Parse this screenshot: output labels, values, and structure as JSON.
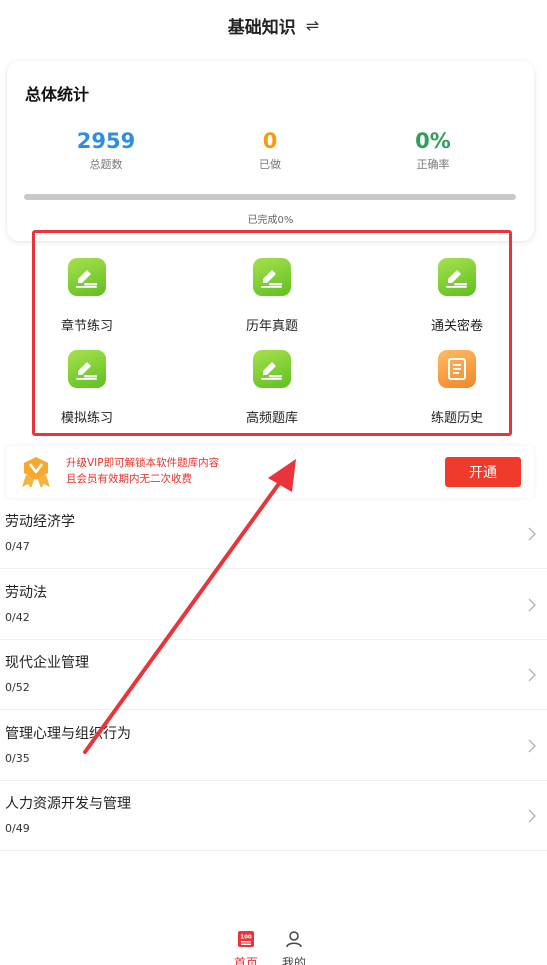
{
  "header": {
    "title": "基础知识",
    "switch_icon": "⇌"
  },
  "stats": {
    "title": "总体统计",
    "total": {
      "value": "2959",
      "label": "总题数"
    },
    "done": {
      "value": "0",
      "label": "已做"
    },
    "rate": {
      "value": "0%",
      "label": "正确率"
    },
    "progress": 0,
    "progress_text": "已完成0%"
  },
  "features": [
    {
      "label": "章节练习",
      "icon": "edit-icon",
      "color": "#6fc72e"
    },
    {
      "label": "历年真题",
      "icon": "edit-icon",
      "color": "#6fc72e"
    },
    {
      "label": "通关密卷",
      "icon": "edit-icon",
      "color": "#6fc72e"
    },
    {
      "label": "模拟练习",
      "icon": "edit-icon",
      "color": "#6fc72e"
    },
    {
      "label": "高频题库",
      "icon": "edit-icon",
      "color": "#6fc72e"
    },
    {
      "label": "练题历史",
      "icon": "history-book-icon",
      "color": "#f39234"
    }
  ],
  "vip": {
    "line1": "升级VIP即可解锁本软件题库内容",
    "line2": "且会员有效期内无二次收费",
    "button": "开通"
  },
  "subjects": [
    {
      "name": "劳动经济学",
      "progress": "0/47"
    },
    {
      "name": "劳动法",
      "progress": "0/42"
    },
    {
      "name": "现代企业管理",
      "progress": "0/52"
    },
    {
      "name": "管理心理与组织行为",
      "progress": "0/35"
    },
    {
      "name": "人力资源开发与管理",
      "progress": "0/49"
    }
  ],
  "tabs": {
    "home": {
      "label": "首页",
      "icon_text": "100"
    },
    "mine": {
      "label": "我的"
    }
  },
  "colors": {
    "accent_red": "#e8343a",
    "blue": "#2f8de4",
    "orange": "#f39c12",
    "green": "#2e9e5b"
  }
}
